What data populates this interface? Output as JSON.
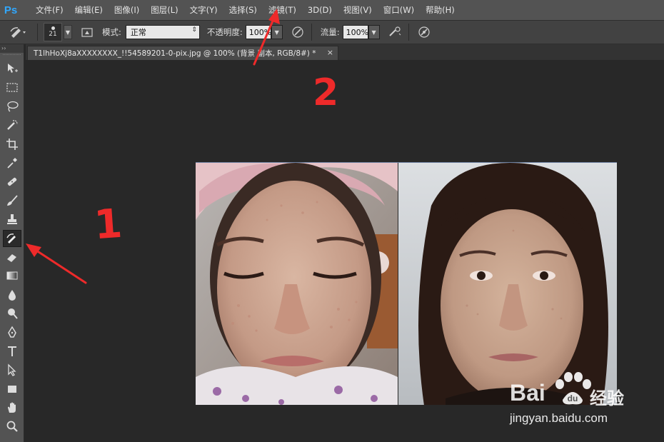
{
  "app": {
    "logo_text": "Ps"
  },
  "menu": {
    "items": [
      "文件(F)",
      "编辑(E)",
      "图像(I)",
      "图层(L)",
      "文字(Y)",
      "选择(S)",
      "滤镜(T)",
      "3D(D)",
      "视图(V)",
      "窗口(W)",
      "帮助(H)"
    ]
  },
  "options": {
    "brush_size": "21",
    "mode_label": "模式:",
    "mode_value": "正常",
    "opacity_label": "不透明度:",
    "opacity_value": "100%",
    "flow_label": "流量:",
    "flow_value": "100%"
  },
  "document": {
    "tab_title": "T1lhHoXj8aXXXXXXXX_!!54589201-0-pix.jpg @ 100% (背景 副本, RGB/8#) *",
    "close_glyph": "×"
  },
  "tools": [
    {
      "name": "move-tool-icon",
      "active": false
    },
    {
      "name": "marquee-tool-icon",
      "active": false
    },
    {
      "name": "lasso-tool-icon",
      "active": false
    },
    {
      "name": "quick-selection-tool-icon",
      "active": false
    },
    {
      "name": "crop-tool-icon",
      "active": false
    },
    {
      "name": "eyedropper-tool-icon",
      "active": false
    },
    {
      "name": "healing-brush-tool-icon",
      "active": false
    },
    {
      "name": "brush-tool-icon",
      "active": false
    },
    {
      "name": "clone-stamp-tool-icon",
      "active": false
    },
    {
      "name": "history-brush-tool-icon",
      "active": true
    },
    {
      "name": "eraser-tool-icon",
      "active": false
    },
    {
      "name": "gradient-tool-icon",
      "active": false
    },
    {
      "name": "blur-tool-icon",
      "active": false
    },
    {
      "name": "dodge-tool-icon",
      "active": false
    },
    {
      "name": "pen-tool-icon",
      "active": false
    },
    {
      "name": "type-tool-icon",
      "active": false
    },
    {
      "name": "path-selection-tool-icon",
      "active": false
    },
    {
      "name": "rectangle-tool-icon",
      "active": false
    },
    {
      "name": "hand-tool-icon",
      "active": false
    },
    {
      "name": "zoom-tool-icon",
      "active": false
    }
  ],
  "annotations": {
    "label_1": "1",
    "label_2": "2",
    "annotation_color": "#ee2a2a"
  },
  "watermark": {
    "brand": "Bai",
    "brand_suffix": "经验",
    "url": "jingyan.baidu.com"
  },
  "colors": {
    "menubar": "#535353",
    "optbar": "#424242",
    "canvas": "#282828",
    "ps_blue": "#31a8ff"
  }
}
